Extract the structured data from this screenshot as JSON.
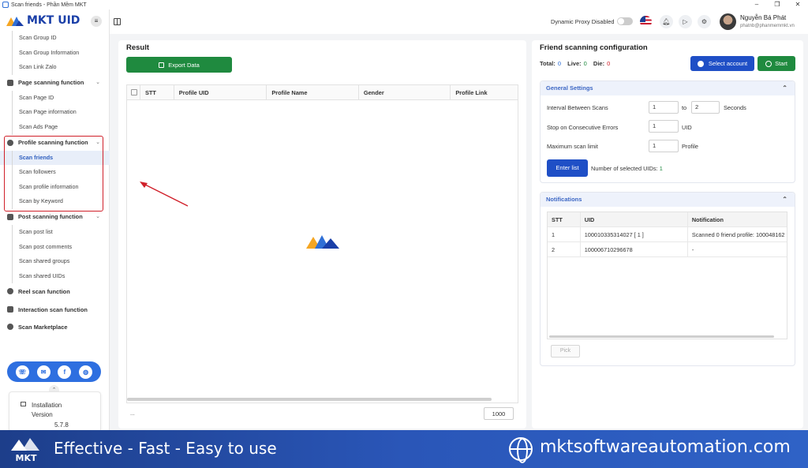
{
  "window": {
    "title": "Scan friends - Phần Mềm MKT",
    "controls": [
      "–",
      "❐",
      "✕"
    ]
  },
  "brand": {
    "logo_text": "MKT UID",
    "hamburger": "≡"
  },
  "sidebar": {
    "items": [
      {
        "type": "sub",
        "label": "Scan Group ID"
      },
      {
        "type": "sub",
        "label": "Scan Group Information"
      },
      {
        "type": "sub",
        "label": "Scan Link Zalo"
      },
      {
        "type": "group",
        "label": "Page scanning function",
        "chev": "⌄"
      },
      {
        "type": "sub",
        "label": "Scan Page ID"
      },
      {
        "type": "sub",
        "label": "Scan Page information"
      },
      {
        "type": "sub",
        "label": "Scan Ads Page"
      },
      {
        "type": "group",
        "label": "Profile scanning function",
        "chev": "⌄"
      },
      {
        "type": "sub",
        "label": "Scan friends",
        "active": true
      },
      {
        "type": "sub",
        "label": "Scan followers"
      },
      {
        "type": "sub",
        "label": "Scan profile information"
      },
      {
        "type": "sub",
        "label": "Scan by Keyword"
      },
      {
        "type": "group",
        "label": "Post scanning function",
        "chev": "⌄"
      },
      {
        "type": "sub",
        "label": "Scan post list"
      },
      {
        "type": "sub",
        "label": "Scan post comments"
      },
      {
        "type": "sub",
        "label": "Scan shared groups"
      },
      {
        "type": "sub",
        "label": "Scan shared UIDs"
      },
      {
        "type": "group",
        "label": "Reel scan function",
        "chev": ""
      },
      {
        "type": "group",
        "label": "Interaction scan function",
        "chev": ""
      },
      {
        "type": "group",
        "label": "Scan Marketplace",
        "chev": ""
      }
    ],
    "social_icons": [
      "support-icon",
      "messenger-icon",
      "facebook-icon",
      "globe-icon"
    ],
    "installation": {
      "label": "Installation Version",
      "version": "5.7.8"
    }
  },
  "topbar": {
    "proxy_label": "Dynamic Proxy Disabled",
    "user_name": "Nguyễn Bá Phát",
    "user_email": "phatnb@phanmemmkt.vn"
  },
  "result": {
    "title": "Result",
    "export_label": "Export Data",
    "columns": [
      "STT",
      "Profile UID",
      "Profile Name",
      "Gender",
      "Profile Link"
    ],
    "footer_left": "...",
    "page_size": "1000"
  },
  "config": {
    "title": "Friend scanning configuration",
    "stats": {
      "total_label": "Total:",
      "total": "0",
      "live_label": "Live:",
      "live": "0",
      "die_label": "Die:",
      "die": "0"
    },
    "select_account_label": "Select account",
    "start_label": "Start",
    "general": {
      "title": "General Settings",
      "interval_label": "Interval Between Scans",
      "interval_from": "1",
      "interval_to_label": "to",
      "interval_to": "2",
      "interval_unit": "Seconds",
      "errors_label": "Stop on Consecutive Errors",
      "errors_value": "1",
      "errors_unit": "UID",
      "limit_label": "Maximum scan limit",
      "limit_value": "1",
      "limit_unit": "Profile",
      "enter_list_label": "Enter list",
      "selected_label": "Number of selected UIDs:",
      "selected_count": "1"
    },
    "notifications": {
      "title": "Notifications",
      "columns": [
        "STT",
        "UID",
        "Notification"
      ],
      "rows": [
        {
          "stt": "1",
          "uid": "100010335314027 [ 1 ]",
          "note": "Scanned 0 friend profile: 100048162"
        },
        {
          "stt": "2",
          "uid": "100006710296678",
          "note": "-"
        }
      ],
      "pick_label": "Pick"
    }
  },
  "banner": {
    "logo_text": "MKT",
    "tagline": "Effective - Fast - Easy to use",
    "site": "mktsoftwareautomation.com"
  },
  "colors": {
    "primary_blue": "#1f4fc6",
    "green": "#1f8a3f",
    "highlight_red": "#d0202a",
    "banner_blue": "#2a56b8"
  }
}
